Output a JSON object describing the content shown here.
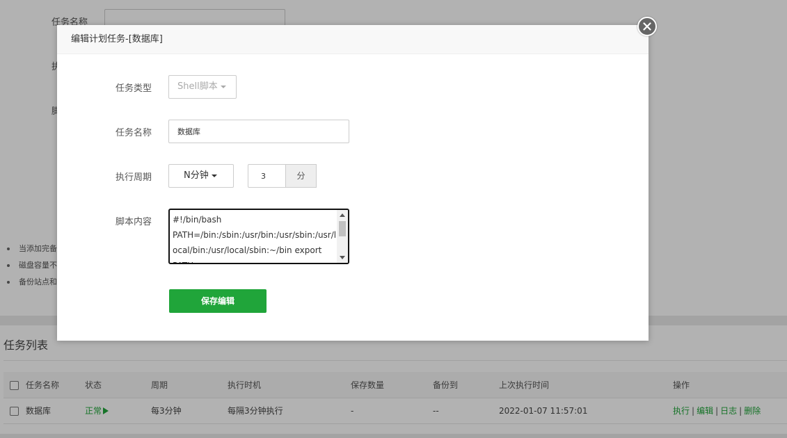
{
  "background": {
    "form": {
      "task_name_label": "任务名称",
      "exec_label_partial": "执",
      "script_label_partial": "脚"
    },
    "tips": [
      "当添加完备",
      "磁盘容量不",
      "备份站点和"
    ],
    "task_list": {
      "title": "任务列表",
      "columns": [
        "任务名称",
        "状态",
        "周期",
        "执行时机",
        "保存数量",
        "备份到",
        "上次执行时间",
        "操作"
      ],
      "rows": [
        {
          "name": "数据库",
          "status": "正常",
          "status_icon": "play-triangle-icon",
          "period": "每3分钟",
          "timing": "每隔3分钟执行",
          "save_count": "-",
          "backup_to": "--",
          "last_run": "2022-01-07 11:57:01",
          "ops": [
            "执行",
            "编辑",
            "日志",
            "删除"
          ]
        }
      ]
    }
  },
  "dialog": {
    "title": "编辑计划任务-[数据库]",
    "close_icon": "close-icon",
    "task_type_label": "任务类型",
    "task_type_value": "Shell脚本",
    "task_name_label": "任务名称",
    "task_name_value": "数据库",
    "cycle_label": "执行周期",
    "cycle_value": "N分钟",
    "cycle_number": "3",
    "cycle_unit": "分",
    "script_label": "脚本内容",
    "script_content": "#!/bin/bash\nPATH=/bin:/sbin:/usr/bin:/usr/sbin:/usr/local/bin:/usr/local/sbin:~/bin export\nPATH...",
    "save_label": "保存编辑"
  },
  "colors": {
    "accent": "#20a53a",
    "overlay": "rgba(0,0,0,0.30)"
  }
}
